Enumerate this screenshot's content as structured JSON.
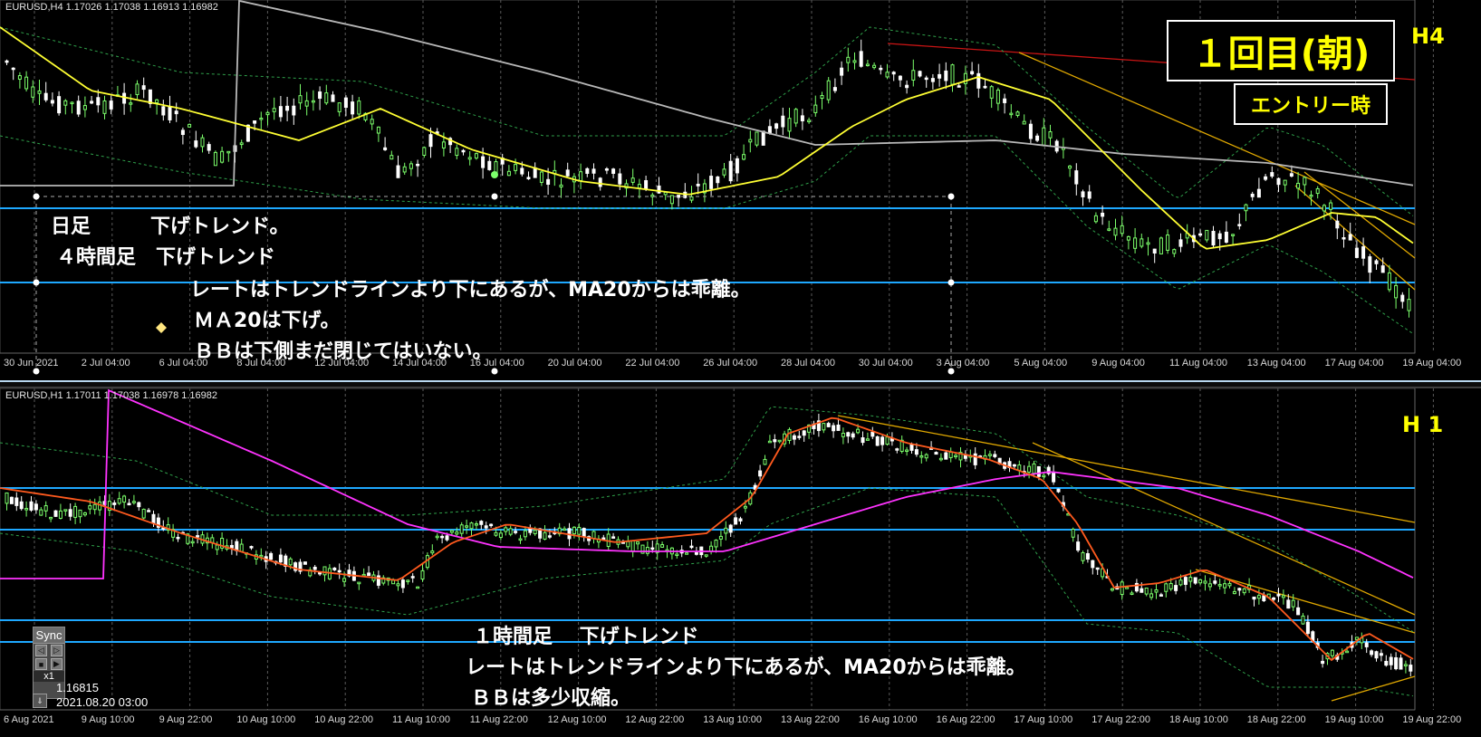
{
  "h4": {
    "symbol_line": "EURUSD,H4  1.17026 1.17038 1.16913 1.16982",
    "tf_label": "H4",
    "title_box": "１回目(朝)",
    "subtitle_box": "エントリー時",
    "notes": [
      "日足　　　下げトレンド。",
      "４時間足　下げトレンド",
      "レートはトレンドラインより下にあるが、MA20からは乖離。",
      "ＭＡ20は下げ。",
      "ＢＢは下側まだ閉じてはいない。"
    ],
    "x_ticks": [
      "30 Jun 2021",
      "2 Jul 04:00",
      "6 Jul 04:00",
      "8 Jul 04:00",
      "12 Jul 04:00",
      "14 Jul 04:00",
      "16 Jul 04:00",
      "20 Jul 04:00",
      "22 Jul 04:00",
      "26 Jul 04:00",
      "28 Jul 04:00",
      "30 Jul 04:00",
      "3 Aug 04:00",
      "5 Aug 04:00",
      "9 Aug 04:00",
      "11 Aug 04:00",
      "13 Aug 04:00",
      "17 Aug 04:00",
      "19 Aug 04:00"
    ]
  },
  "h1": {
    "symbol_line": "EURUSD,H1  1.17011 1.17038 1.16978 1.16982",
    "tf_label": "H 1",
    "notes": [
      "１時間足　 下げトレンド",
      "レートはトレンドラインより下にあるが、MA20からは乖離。",
      "ＢＢは多少収縮。"
    ],
    "x_ticks": [
      "6 Aug 2021",
      "9 Aug 10:00",
      "9 Aug 22:00",
      "10 Aug 10:00",
      "10 Aug 22:00",
      "11 Aug 10:00",
      "11 Aug 22:00",
      "12 Aug 10:00",
      "12 Aug 22:00",
      "13 Aug 10:00",
      "13 Aug 22:00",
      "16 Aug 10:00",
      "16 Aug 22:00",
      "17 Aug 10:00",
      "17 Aug 22:00",
      "18 Aug 10:00",
      "18 Aug 22:00",
      "19 Aug 10:00",
      "19 Aug 22:00"
    ],
    "sync": {
      "label": "Sync",
      "zoom": "x1",
      "price": "1.16815",
      "datetime": "2021.08.20 03:00"
    }
  },
  "colors": {
    "background": "#000000",
    "candle_up": "#7cff6b",
    "candle_down": "#ffffff",
    "ma20_h4": "#ffff33",
    "ma_long_h4": "#b8b8b8",
    "ma20_h1": "#ff5a1e",
    "ma_long_h1": "#ff33ff",
    "bollinger": "#2fa04a",
    "horizontal_line": "#1ea8ff",
    "trendline": "#e0a800",
    "trendline_red": "#c81414",
    "label": "#ffff00"
  }
}
